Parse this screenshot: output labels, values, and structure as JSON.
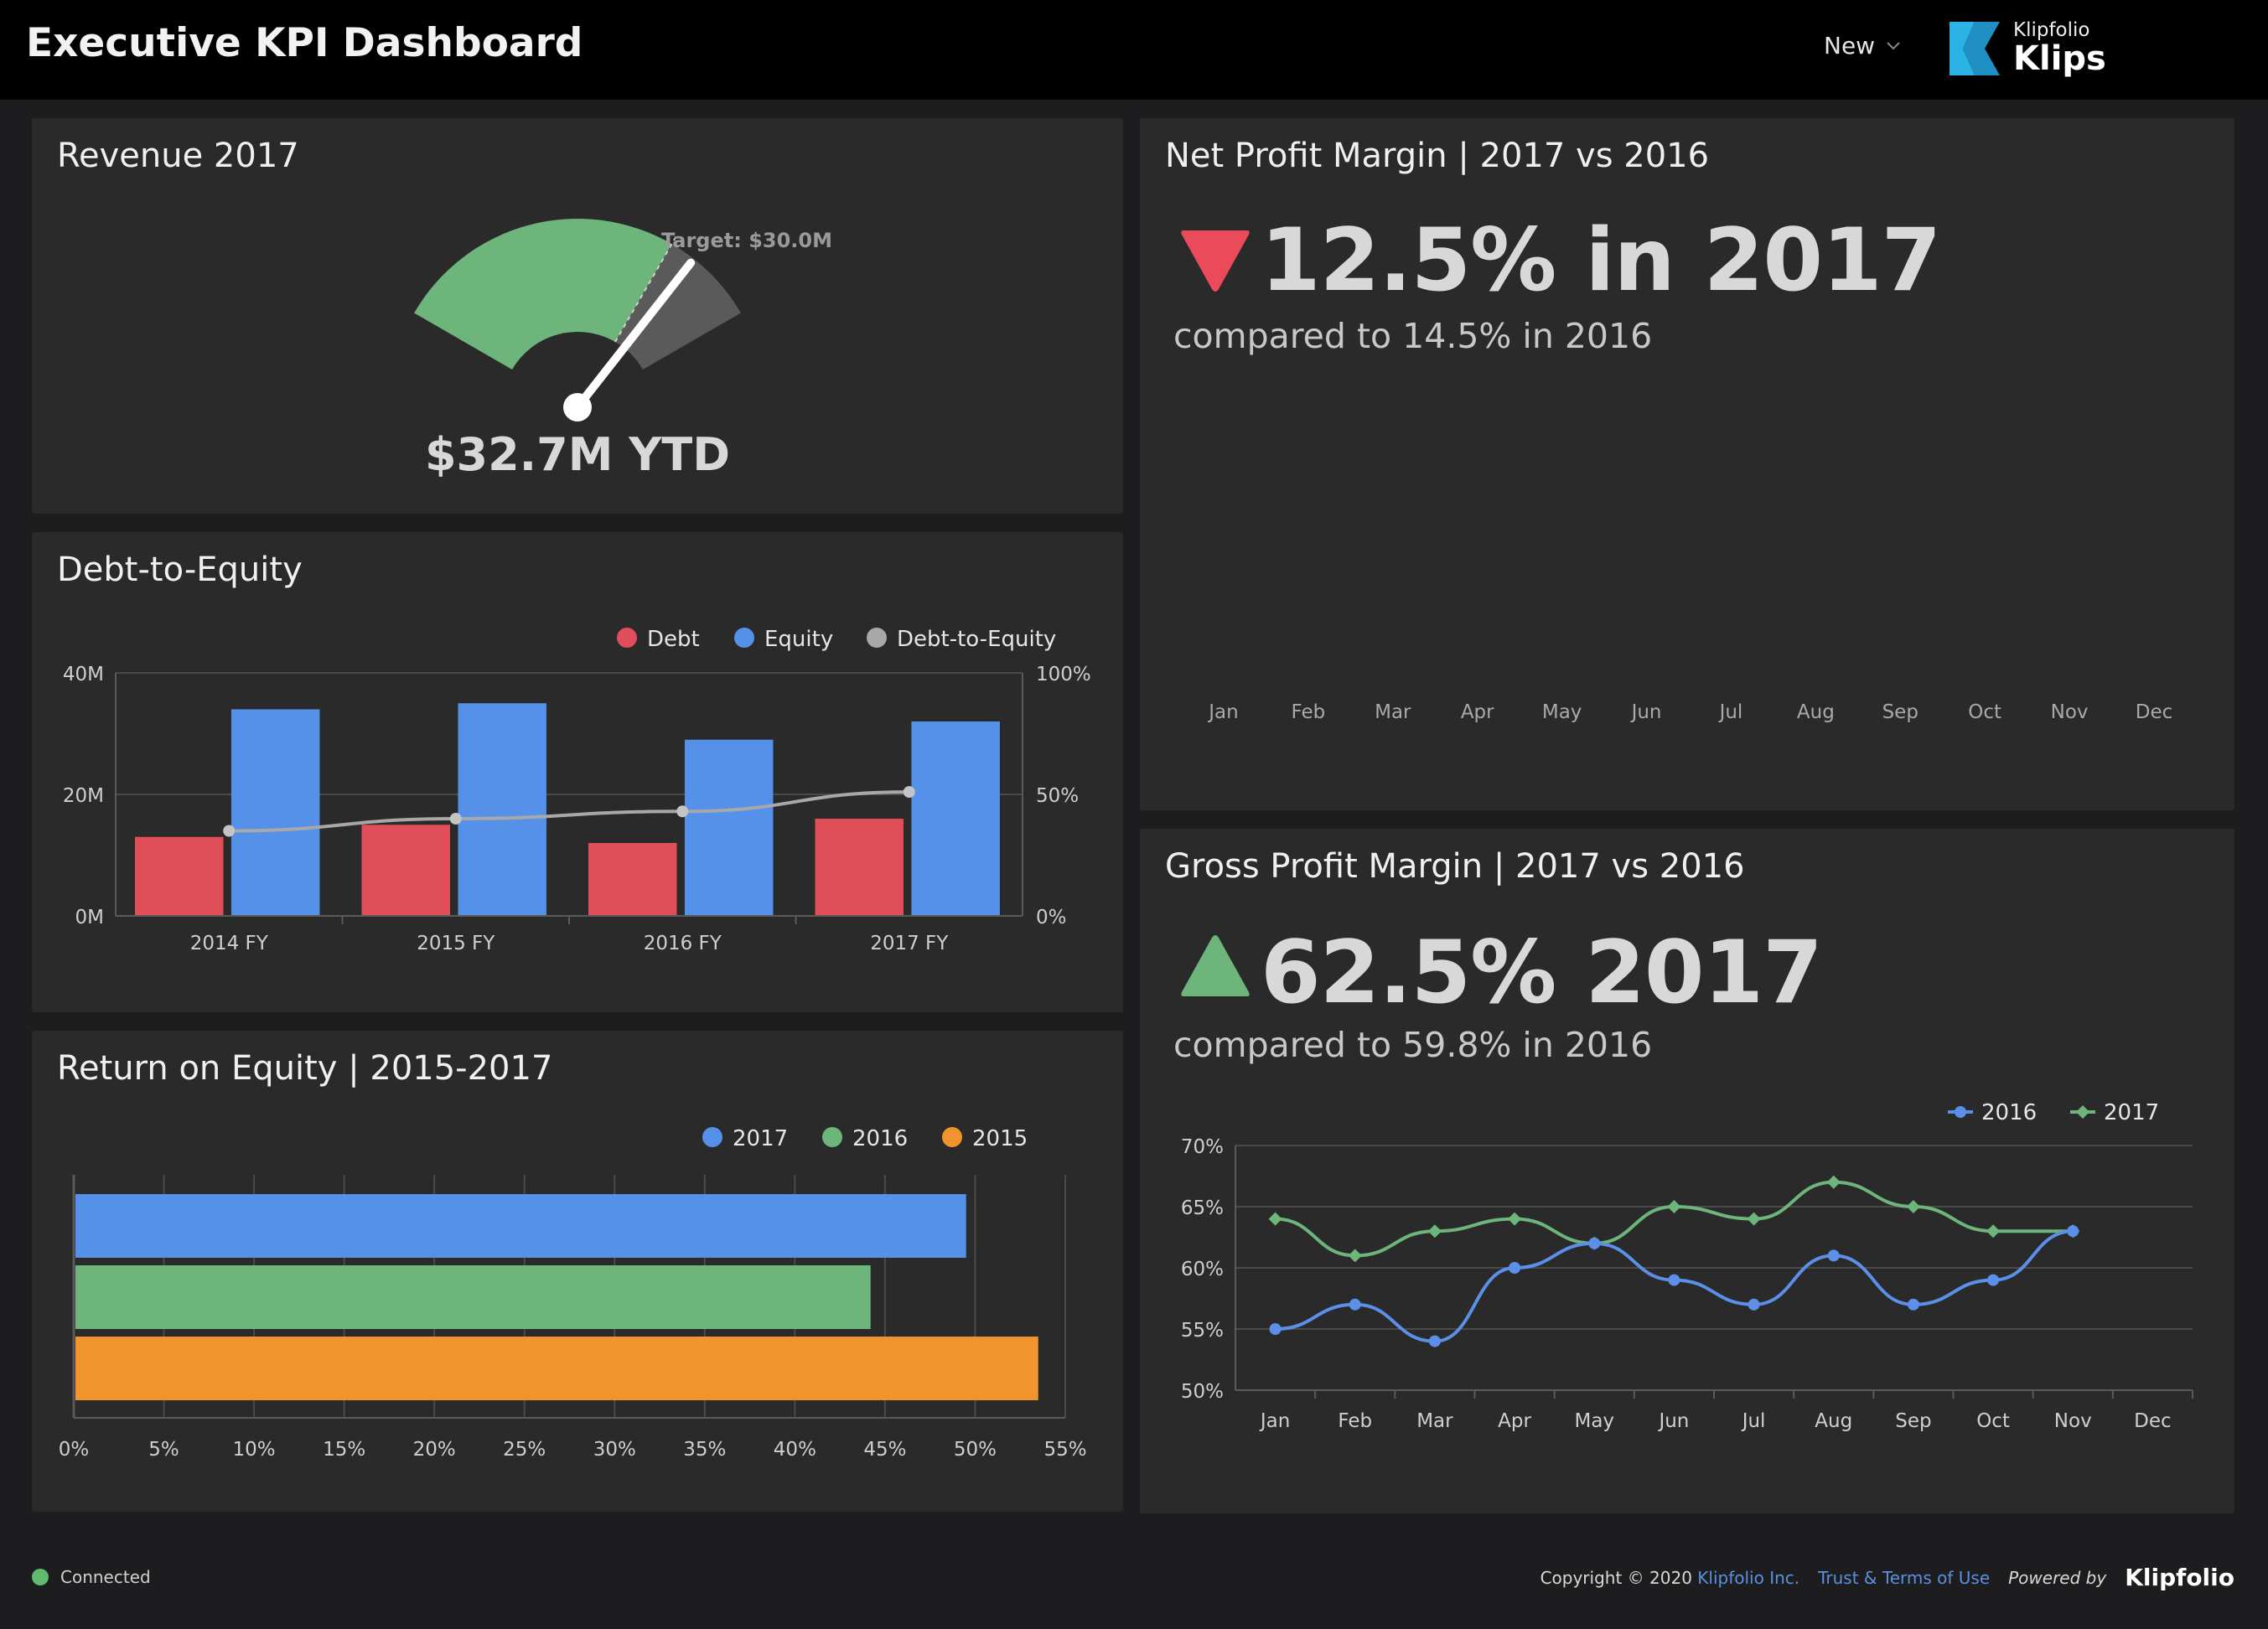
{
  "header": {
    "title": "Executive KPI Dashboard",
    "new_label": "New",
    "brand_small": "Klipfolio",
    "brand_big": "Klips"
  },
  "revenue": {
    "title": "Revenue 2017",
    "target_label": "Target: $30.0M",
    "value_label": "$32.7M YTD",
    "gauge": {
      "value": 32.7,
      "target": 30.0,
      "max": 40.0,
      "unit": "$M"
    }
  },
  "debt_equity": {
    "title": "Debt-to-Equity",
    "legend": [
      "Debt",
      "Equity",
      "Debt-to-Equity"
    ]
  },
  "roe": {
    "title": "Return on Equity | 2015-2017",
    "legend": [
      "2017",
      "2016",
      "2015"
    ]
  },
  "net_profit": {
    "title": "Net Profit Margin | 2017 vs 2016",
    "value": "12.5% in 2017",
    "compare": "compared to 14.5% in 2016",
    "trend": "down",
    "months": [
      "Jan",
      "Feb",
      "Mar",
      "Apr",
      "May",
      "Jun",
      "Jul",
      "Aug",
      "Sep",
      "Oct",
      "Nov",
      "Dec"
    ]
  },
  "gross_profit": {
    "title": "Gross Profit Margin | 2017 vs 2016",
    "value": "62.5% 2017",
    "compare": "compared to 59.8% in 2016",
    "trend": "up"
  },
  "colors": {
    "debt": "#e04e5a",
    "equity": "#5591e8",
    "ratio": "#a8a8a8",
    "roe_2017": "#5591e8",
    "roe_2016": "#6db57a",
    "roe_2015": "#f0952e",
    "gpm_2016": "#5b8fe8",
    "gpm_2017": "#6db57a",
    "down": "#ea4a5a",
    "up": "#6db57a",
    "gauge_green": "#6db57a",
    "gauge_grey": "#5a5a5a"
  },
  "chart_data": [
    {
      "type": "bar",
      "title": "Debt-to-Equity",
      "categories": [
        "2014 FY",
        "2015 FY",
        "2016 FY",
        "2017 FY"
      ],
      "series": [
        {
          "name": "Debt",
          "values": [
            13,
            15,
            12,
            16
          ]
        },
        {
          "name": "Equity",
          "values": [
            34,
            35,
            29,
            32
          ]
        },
        {
          "name": "Debt-to-Equity",
          "values": [
            35,
            40,
            43,
            51
          ],
          "kind": "line",
          "axis": "right",
          "has_marker": [
            true,
            true,
            true,
            true
          ]
        }
      ],
      "ylim": [
        0,
        40
      ],
      "y_ticks": [
        "0M",
        "20M",
        "40M"
      ],
      "y2lim": [
        0,
        100
      ],
      "y2_ticks": [
        "0%",
        "50%",
        "100%"
      ],
      "legend": "top-right"
    },
    {
      "type": "bar",
      "orientation": "horizontal",
      "title": "Return on Equity | 2015-2017",
      "series": [
        {
          "name": "2017",
          "values": [
            49.5
          ]
        },
        {
          "name": "2016",
          "values": [
            44.2
          ]
        },
        {
          "name": "2015",
          "values": [
            53.5
          ]
        }
      ],
      "xlim": [
        0,
        55
      ],
      "x_ticks": [
        "0%",
        "5%",
        "10%",
        "15%",
        "20%",
        "25%",
        "30%",
        "35%",
        "40%",
        "45%",
        "50%",
        "55%"
      ],
      "legend": "top-right"
    },
    {
      "type": "line",
      "title": "Gross Profit Margin | 2017 vs 2016",
      "categories": [
        "Jan",
        "Feb",
        "Mar",
        "Apr",
        "May",
        "Jun",
        "Jul",
        "Aug",
        "Sep",
        "Oct",
        "Nov",
        "Dec"
      ],
      "series": [
        {
          "name": "2016",
          "values": [
            55,
            57,
            54,
            60,
            62,
            59,
            57,
            61,
            57,
            59,
            63
          ]
        },
        {
          "name": "2017",
          "values": [
            64,
            61,
            63,
            64,
            62,
            65,
            64,
            67,
            65,
            63,
            63
          ]
        }
      ],
      "ylim": [
        50,
        70
      ],
      "y_ticks": [
        "50%",
        "55%",
        "60%",
        "65%",
        "70%"
      ],
      "legend": "top-right"
    }
  ],
  "footer": {
    "status": "Connected",
    "copyright": "Copyright © 2020",
    "company": "Klipfolio Inc.",
    "terms": "Trust & Terms of Use",
    "powered": "Powered by",
    "logo": "Klipfolio"
  }
}
